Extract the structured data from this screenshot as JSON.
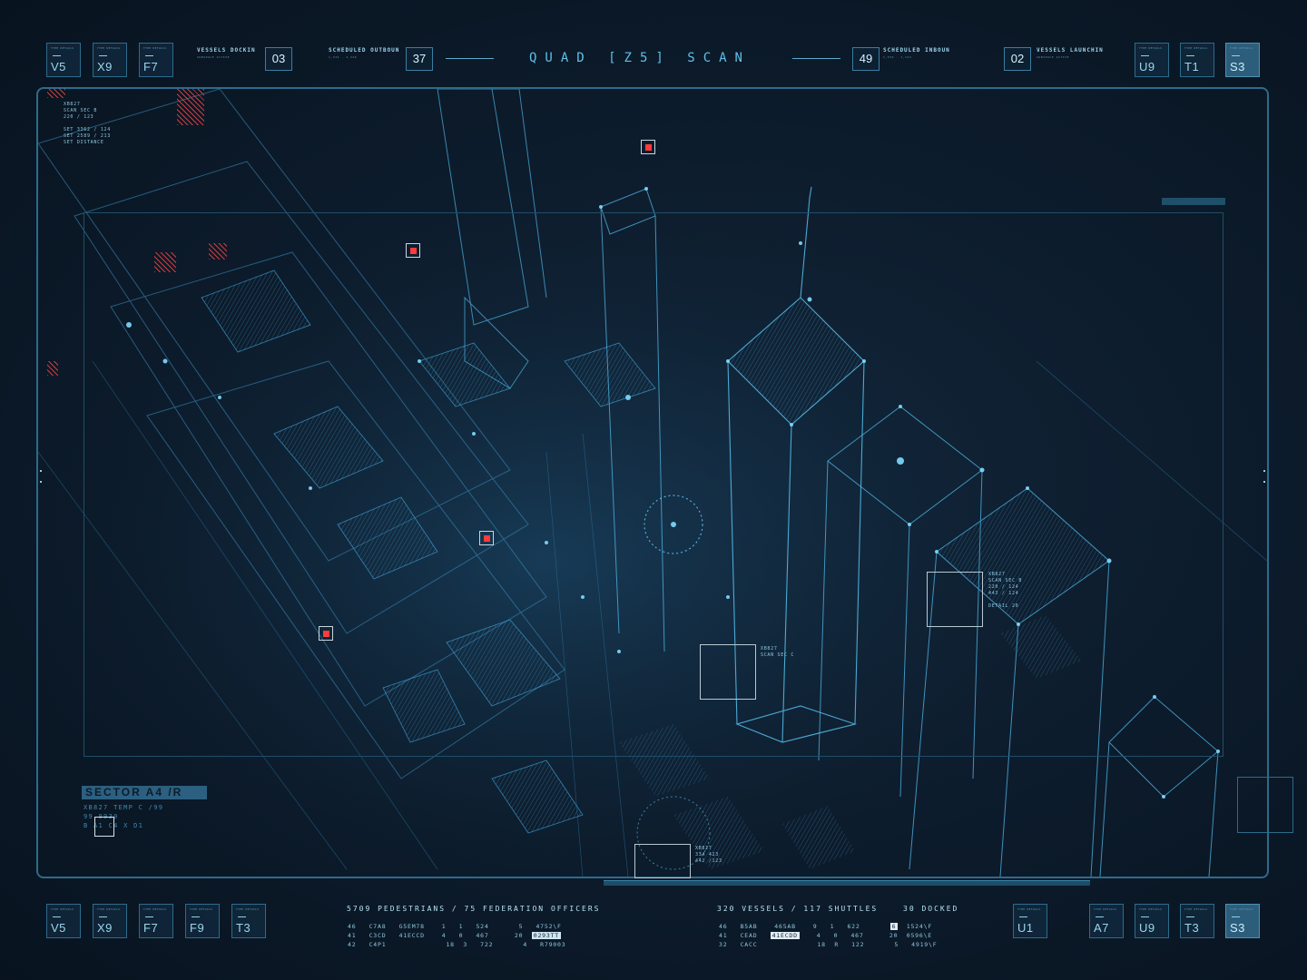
{
  "title": "QUAD [Z5] SCAN",
  "colors": {
    "accent": "#5fc0ea",
    "alert": "#ff3b3b",
    "frame": "#2d6b8b",
    "background": "#0b1826"
  },
  "top": {
    "left_tiles": [
      "V5",
      "X9",
      "F7"
    ],
    "right_tiles": [
      "U9",
      "T1",
      "S3"
    ],
    "tile_caption": "TYPE DETAILS",
    "stats": [
      {
        "title": "VESSELS DOCKIN",
        "sub": "SUBSPACE ACTIVE",
        "value": "03"
      },
      {
        "title": "SCHEDULED OUTBOUN",
        "sub": "1,334 - 2,346",
        "value": "37"
      },
      {
        "title": "SCHEDULED INBOUN",
        "sub": "1,556 - 1,324",
        "value": "49"
      },
      {
        "title": "VESSELS LAUNCHIN",
        "sub": "SUBSPACE ACTIVE",
        "value": "02"
      }
    ]
  },
  "annotations": {
    "top_left": "XB827\nSCAN SEC B\n220 / 123\n\nSET 3362 / 124\nSET 2589 / 213\nSET DISTANCE",
    "right": "XB827\nSCAN SEC B\n220 / 124\n443 / 124\n\nDETAIL 20",
    "middle": "XB827\nSCAN SEC C",
    "bottom": "XB827\n334 423\n442 /123"
  },
  "sector": {
    "label": "SECTOR A4 /R",
    "line1": "XB827 TEMP  C     /99",
    "line2": "99     9930",
    "line3": "B     A1 C4   X    D1"
  },
  "bottom": {
    "left_tiles": [
      "V5",
      "X9",
      "F7",
      "F9",
      "T3"
    ],
    "right_tiles_a": [
      "U1"
    ],
    "right_tiles_b": [
      "A7",
      "U9",
      "T3",
      "S3"
    ],
    "people_header": "5709 PEDESTRIANS / 75 FEDERATION OFFICERS",
    "people_rows": [
      [
        "46",
        "C7A8",
        "G5EM78",
        "1",
        "1",
        "524",
        "5",
        "4752\\F"
      ],
      [
        "41",
        "C3CD",
        "41ECCD",
        "4",
        "0",
        "467",
        "20",
        "0293TT"
      ],
      [
        "42",
        "C4P1",
        "",
        "18",
        "3",
        "722",
        "4",
        "R79003"
      ]
    ],
    "vessels_header": "320 VESSELS / 117 SHUTTLES",
    "docked": "30 DOCKED",
    "vessel_rows": [
      [
        "46",
        "B5AB",
        "465AB",
        "9",
        "1",
        "622",
        "6",
        "1524\\F"
      ],
      [
        "41",
        "CEAD",
        "41ECDD",
        "4",
        "0",
        "467",
        "20",
        "0596\\E"
      ],
      [
        "32",
        "CACC",
        "",
        "18",
        "R",
        "122",
        "5",
        "4919\\F"
      ]
    ]
  }
}
